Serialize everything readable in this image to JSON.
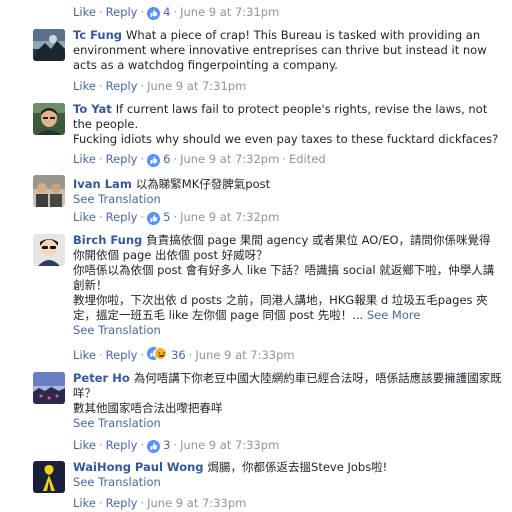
{
  "common": {
    "like": "Like",
    "reply": "Reply",
    "dot": "·",
    "see_translation": "See Translation",
    "see_more": "See More"
  },
  "top_actions": {
    "count": "4",
    "time": "June 9 at 7:31pm"
  },
  "comments": [
    {
      "author": "Tc Fung",
      "text": "What a piece of crap! This Bureau is tasked with providing an environment where innovative entreprises can thrive but instead it now acts as a watchdog fingerpointing a company.",
      "time": "June 9 at 7:31pm",
      "count": ""
    },
    {
      "author": "To Yat",
      "text": "If current laws fail to protect people's rights, revise the laws, not the people.",
      "text2": "Fucking idiots why should we even pay taxes to these fucktard dickfaces?",
      "time": "June 9 at 7:32pm",
      "count": "6",
      "edited": "Edited"
    },
    {
      "author": "Ivan Lam",
      "text": "以為睇緊MK仔發脾氣post",
      "time": "June 9 at 7:32pm",
      "count": "5"
    },
    {
      "author": "Birch Fung",
      "text": "負責搞依個 page 果間 agency 或者果位 AO/EO，請問你係咪覺得你開依個 page 出依個 post 好威呀？",
      "text2": "你唔係以為依個 post 會有好多人 like 下話？唔識搞 social 就返鄉下啦，仲學人講創新！",
      "text3": "教埋你啦，下次出依 d posts 之前，同港人講地，HKG報果 d 垃圾五毛pages 夾定，搵定一班五毛 like 左你個 page 同個 post 先啦！...",
      "time": "June 9 at 7:33pm",
      "count": "36"
    },
    {
      "author": "Peter Ho",
      "text": "為何唔講下你老豆中國大陸網約車已經合法呀，唔係話應該要擁護國家既咩？",
      "text2": "數其他國家唔合法出嚟把春咩",
      "time": "June 9 at 7:33pm",
      "count": "3"
    },
    {
      "author": "WaiHong Paul Wong",
      "text": "焗腸，你都係返去搵Steve Jobs啦!",
      "time": "June 9 at 7:33pm",
      "count": ""
    }
  ],
  "colors": {
    "link": "#4b67a1",
    "author": "#365899",
    "meta": "#90949c",
    "like_badge": "#5890ff",
    "haha_badge": "#f7b125"
  }
}
